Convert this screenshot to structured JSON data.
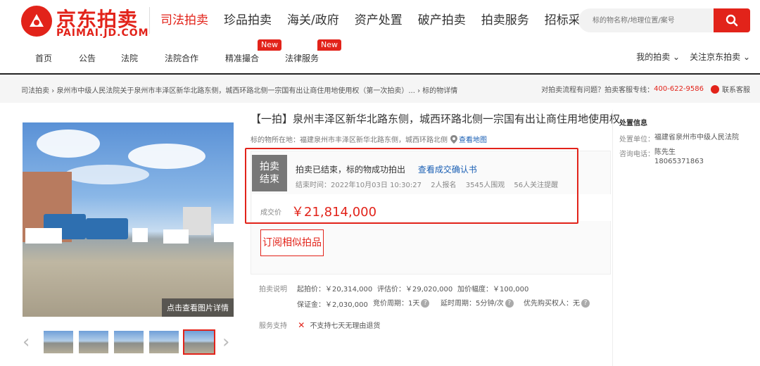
{
  "header": {
    "logo_cn": "京东拍卖",
    "logo_en": "PAIMAI.JD.COM",
    "main_nav": [
      "司法拍卖",
      "珍品拍卖",
      "海关/政府",
      "资产处置",
      "破产拍卖",
      "拍卖服务",
      "招标采购"
    ],
    "search_placeholder": "标的物名称/地理位置/案号",
    "sub_nav": {
      "home": "首页",
      "notice": "公告",
      "court": "法院",
      "court_coop": "法院合作",
      "match": "精准撮合",
      "legal": "法律服务",
      "badge_new": "New"
    },
    "my_auction": "我的拍卖",
    "follow": "关注京东拍卖"
  },
  "breadcrumb": {
    "root": "司法拍卖",
    "item": "泉州市中级人民法院关于泉州市丰泽区新华北路东侧，城西环路北侧一宗国有出让商住用地使用权（第一次拍卖）...",
    "current": "标的物详情",
    "help_text": "对拍卖流程有问题？拍卖客服专线：",
    "phone": "400-622-9586",
    "service": "联系客服"
  },
  "gallery": {
    "caption": "点击查看图片详情"
  },
  "lot": {
    "title": "【一拍】泉州丰泽区新华北路东侧，城西环路北侧一宗国有出让商住用地使用权",
    "location_label": "标的物所在地：",
    "location": "福建泉州市丰泽区新华北路东侧，城西环路北侧",
    "map_link": "查看地图"
  },
  "status": {
    "tag_line1": "拍卖",
    "tag_line2": "结束",
    "text": "拍卖已结束，标的物成功拍出",
    "link": "查看成交确认书",
    "end_time": "结束时间：2022年10月03日 10:30:27",
    "signups": "2人报名",
    "views": "3545人围观",
    "reminders": "56人关注提醒",
    "price_label": "成交价",
    "price": "￥21,814,000",
    "subscribe": "订阅相似拍品"
  },
  "terms": {
    "label": "拍卖说明",
    "start_price": "起拍价：￥20,314,000",
    "appraisal": "评估价：￥29,020,000",
    "increment": "加价幅度：￥100,000",
    "deposit": "保证金：￥2,030,000",
    "cycle": "竞价周期：1天",
    "extension": "延时周期：5分钟/次",
    "priority": "优先购买权人：无",
    "service_label": "服务支持",
    "service_note": "不支持七天无理由退货"
  },
  "disposal": {
    "head": "处置信息",
    "unit_label": "处置单位：",
    "unit": "福建省泉州市中级人民法院",
    "phone_label": "咨询电话：",
    "contact": "陈先生",
    "phone": "18065371863"
  }
}
